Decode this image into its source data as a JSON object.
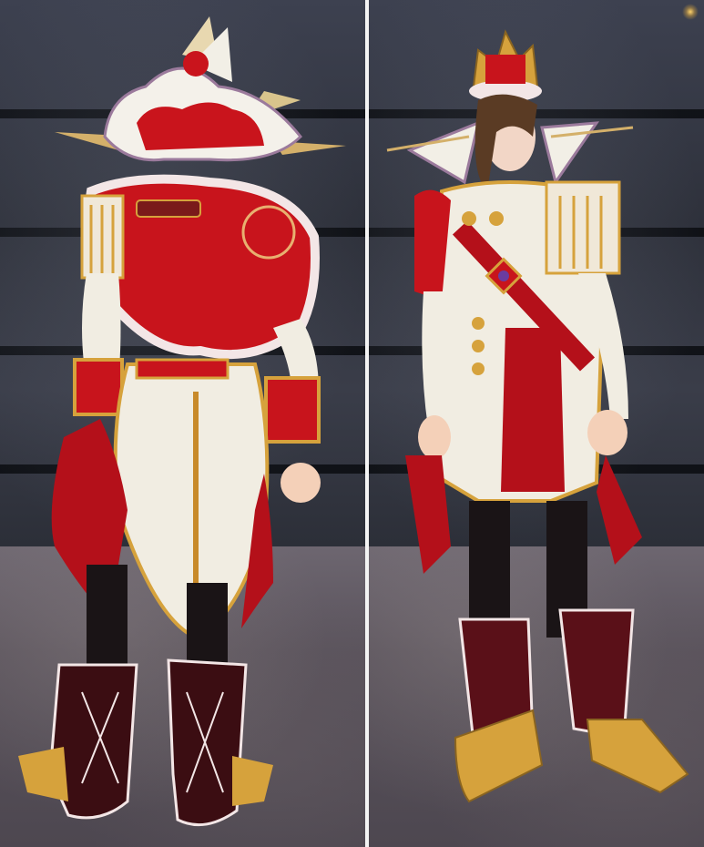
{
  "scene": {
    "panels": [
      {
        "view": "back"
      },
      {
        "view": "front"
      }
    ],
    "colors": {
      "wall": "#343844",
      "floor": "#5e5760",
      "costume_red": "#c8141c",
      "costume_white": "#f1ede2",
      "gold": "#d6a23c",
      "fur": "#f3e6e6",
      "boots_black": "#1a1416"
    }
  }
}
